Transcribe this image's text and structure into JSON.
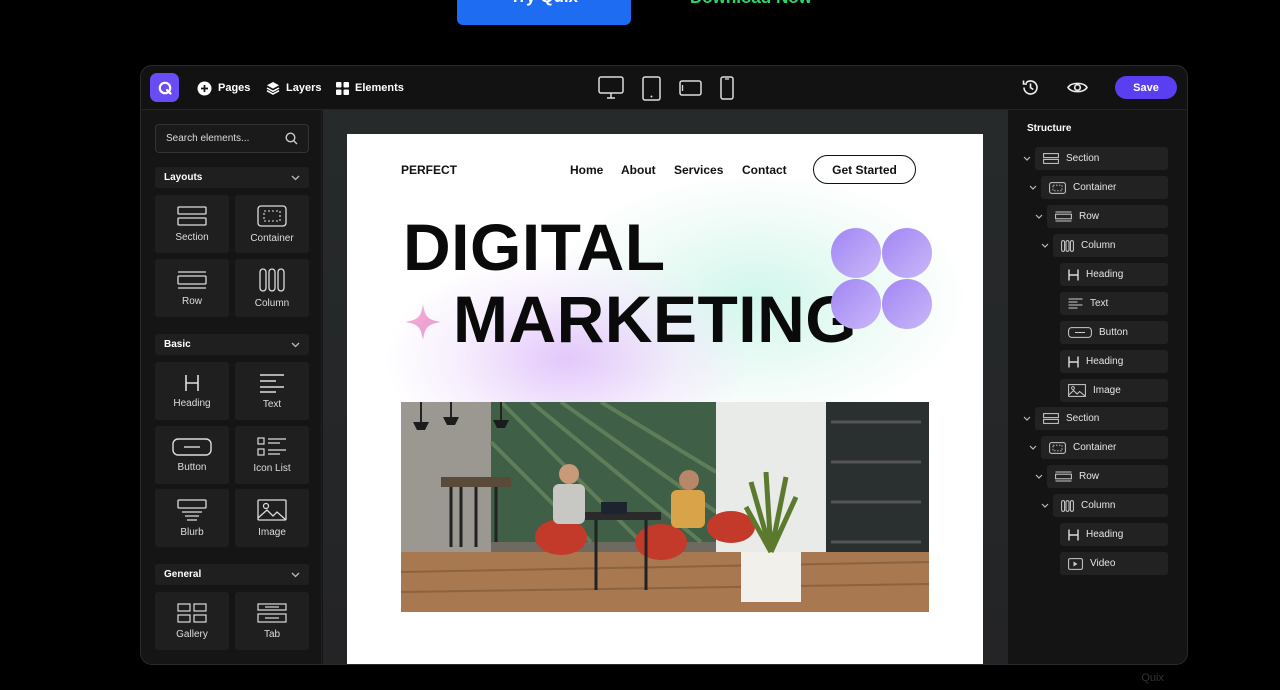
{
  "hero": {
    "try_label": "Try Quix",
    "download_label": "Download Now"
  },
  "topbar": {
    "logo_letter": "Q",
    "pages_label": "Pages",
    "layers_label": "Layers",
    "elements_label": "Elements",
    "save_label": "Save"
  },
  "left_panel": {
    "search_placeholder": "Search elements...",
    "groups": [
      {
        "title": "Layouts",
        "items": [
          "Section",
          "Container",
          "Row",
          "Column"
        ]
      },
      {
        "title": "Basic",
        "items": [
          "Heading",
          "Text",
          "Button",
          "Icon List",
          "Blurb",
          "Image"
        ]
      },
      {
        "title": "General",
        "items": [
          "Gallery",
          "Tab"
        ]
      }
    ]
  },
  "page": {
    "brand": "PERFECT",
    "nav": [
      "Home",
      "About",
      "Services",
      "Contact"
    ],
    "cta": "Get Started",
    "headline_1": "DIGITAL",
    "headline_2": "MARKETING"
  },
  "structure": {
    "title": "Structure",
    "items": [
      "Section",
      "Container",
      "Row",
      "Column",
      "Heading",
      "Text",
      "Button",
      "Heading",
      "Image",
      "Section",
      "Container",
      "Row",
      "Column",
      "Heading",
      "Video"
    ]
  },
  "colors": {
    "accent": "#5a3ff0",
    "try_blue": "#1e6cf2",
    "download_green": "#2ad96a"
  },
  "watermark": "Quix"
}
